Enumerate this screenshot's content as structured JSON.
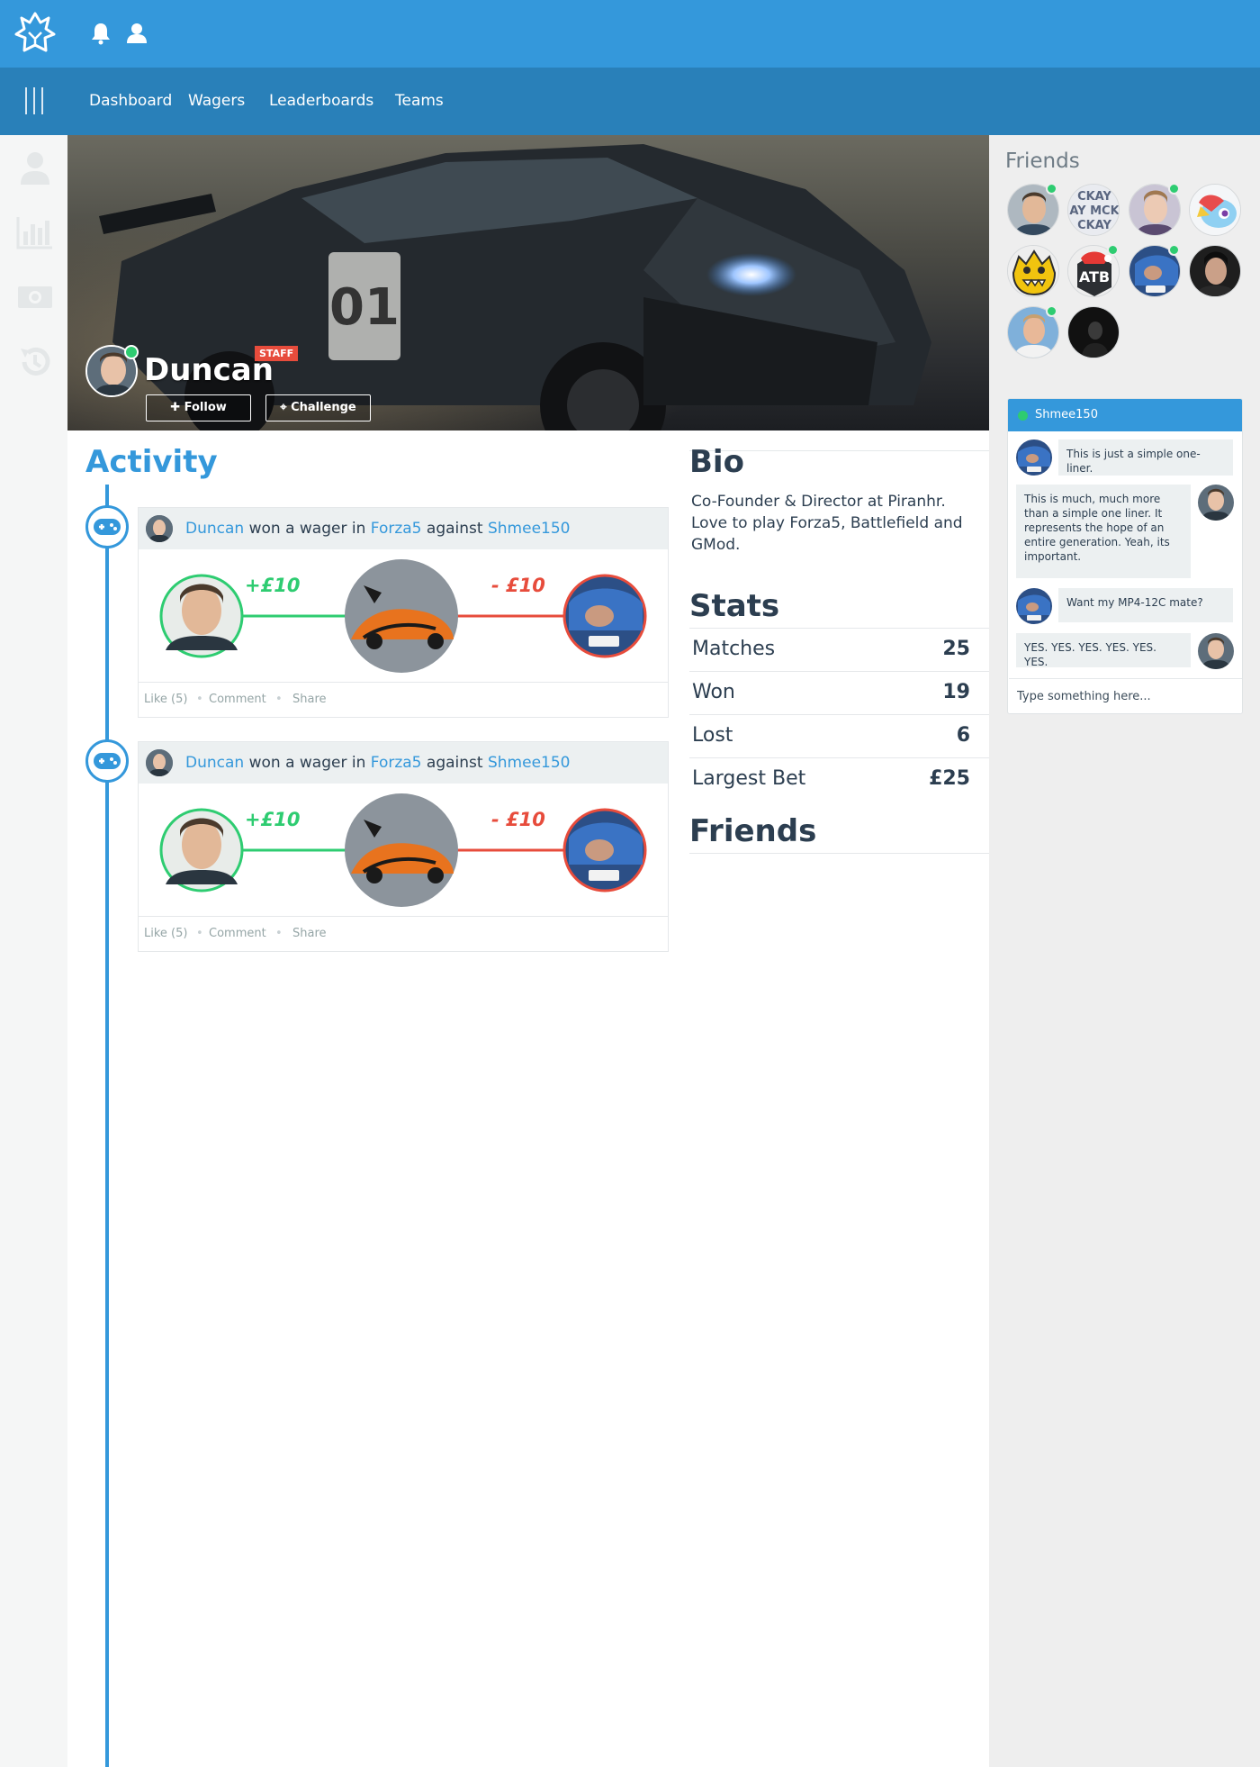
{
  "nav": {
    "items": [
      {
        "label": "Dashboard"
      },
      {
        "label": "Wagers"
      },
      {
        "label": "Leaderboards"
      },
      {
        "label": "Teams"
      }
    ]
  },
  "profile": {
    "name": "Duncan",
    "badge": "STAFF",
    "follow_label": "✚ Follow",
    "challenge_label": "⌖ Challenge",
    "online": true
  },
  "activity": {
    "title": "Activity",
    "items": [
      {
        "user": "Duncan",
        "verb": "won a wager in",
        "game": "Forza5",
        "connector": "against",
        "opponent": "Shmee150",
        "win_amount": "+£10",
        "loss_amount": "- £10",
        "like_label": "Like (5)",
        "comment_label": "Comment",
        "share_label": "Share"
      },
      {
        "user": "Duncan",
        "verb": "won a wager in",
        "game": "Forza5",
        "connector": "against",
        "opponent": "Shmee150",
        "win_amount": "+£10",
        "loss_amount": "- £10",
        "like_label": "Like (5)",
        "comment_label": "Comment",
        "share_label": "Share"
      }
    ]
  },
  "bio": {
    "title": "Bio",
    "text": "Co-Founder & Director at Piranhr. Love to play Forza5, Battlefield and GMod."
  },
  "stats": {
    "title": "Stats",
    "rows": [
      {
        "label": "Matches",
        "value": "25"
      },
      {
        "label": "Won",
        "value": "19"
      },
      {
        "label": "Lost",
        "value": "6"
      },
      {
        "label": "Largest Bet",
        "value": "£25"
      }
    ]
  },
  "friends_section": {
    "title": "Friends"
  },
  "sidebar_friends": {
    "title": "Friends",
    "list": [
      {
        "avatar": "duncan",
        "online": true
      },
      {
        "avatar": "text-logo",
        "online": false
      },
      {
        "avatar": "person-light",
        "online": true
      },
      {
        "avatar": "pony",
        "online": false
      },
      {
        "avatar": "monster",
        "online": false
      },
      {
        "avatar": "atb",
        "online": true
      },
      {
        "avatar": "car-blue",
        "online": true
      },
      {
        "avatar": "person-dark",
        "online": false
      },
      {
        "avatar": "person-outdoor",
        "online": true
      },
      {
        "avatar": "silhouette",
        "online": false
      }
    ],
    "logo_text": [
      "CKAY",
      "AY MCK",
      "CKAY"
    ],
    "atb_text": "ATB"
  },
  "chat": {
    "contact": "Shmee150",
    "messages": [
      {
        "from": "them",
        "text": "This is just a simple one-liner."
      },
      {
        "from": "me",
        "text": "This is much, much more than a simple one liner. It represents the hope of an entire generation. Yeah, its important."
      },
      {
        "from": "them",
        "text": "Want my MP4-12C mate?"
      },
      {
        "from": "me",
        "text": "YES. YES. YES. YES. YES. YES."
      }
    ],
    "input_placeholder": "Type something here..."
  },
  "colors": {
    "primary": "#3498db",
    "nav": "#2980b9",
    "win": "#2ecc71",
    "loss": "#e74c3c",
    "online": "#2ecc71"
  }
}
